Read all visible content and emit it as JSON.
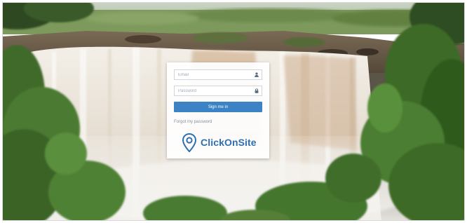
{
  "login": {
    "email_placeholder": "Email",
    "password_placeholder": "Password",
    "signin_label": "Sign me in",
    "forgot_label": "Forgot my password"
  },
  "brand": {
    "name": "ClickOnSite",
    "logo_icon": "location-pin-icon"
  },
  "icons": {
    "email_field_icon": "person-icon",
    "password_field_icon": "lock-icon"
  },
  "colors": {
    "accent": "#3b83c4",
    "brand": "#2f6fb0",
    "card_bg": "#ffffff"
  }
}
